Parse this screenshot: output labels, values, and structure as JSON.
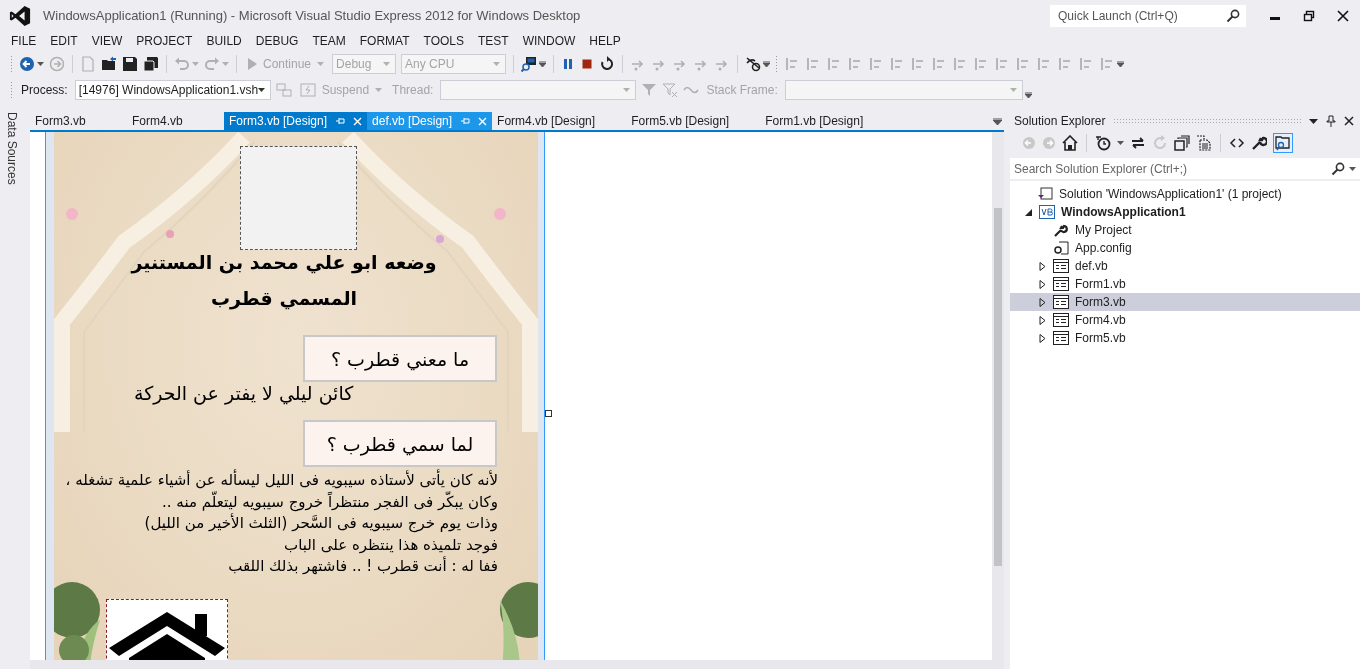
{
  "window": {
    "title": "WindowsApplication1 (Running) - Microsoft Visual Studio Express 2012 for Windows Desktop"
  },
  "quick_launch": {
    "placeholder": "Quick Launch (Ctrl+Q)"
  },
  "menu": [
    "FILE",
    "EDIT",
    "VIEW",
    "PROJECT",
    "BUILD",
    "DEBUG",
    "TEAM",
    "FORMAT",
    "TOOLS",
    "TEST",
    "WINDOW",
    "HELP"
  ],
  "debug_toolbar": {
    "continue": {
      "label": "Continue",
      "disabled": true
    },
    "configuration": {
      "value": "Debug",
      "disabled": true
    },
    "platform": {
      "value": "Any CPU",
      "disabled": true
    }
  },
  "debug_location": {
    "process_label": "Process:",
    "process": "[14976] WindowsApplication1.vsh",
    "suspend": {
      "label": "Suspend",
      "disabled": true
    },
    "thread_label": "Thread:",
    "stack_frame_label": "Stack Frame:"
  },
  "side_tab": "Data Sources",
  "document_tabs": [
    {
      "label": "Form3.vb",
      "selected": false,
      "pinned": false,
      "hovered": false
    },
    {
      "label": "Form4.vb",
      "selected": false,
      "pinned": false,
      "hovered": false
    },
    {
      "label": "Form3.vb [Design]",
      "selected": true,
      "pinned": true,
      "hovered": false
    },
    {
      "label": "def.vb [Design]",
      "selected": false,
      "pinned": true,
      "hovered": true
    },
    {
      "label": "Form4.vb [Design]",
      "selected": false,
      "pinned": false,
      "hovered": false
    },
    {
      "label": "Form5.vb [Design]",
      "selected": false,
      "pinned": false,
      "hovered": false
    },
    {
      "label": "Form1.vb [Design]",
      "selected": false,
      "pinned": false,
      "hovered": false
    }
  ],
  "form": {
    "heading": "وضعه ابو علي محمد بن المستنير\nالمسمي قطرب",
    "buttons": [
      "ما معني قطرب ؟",
      "لما سمي قطرب ؟"
    ],
    "answer": "كائن ليلي لا يفتر عن الحركة",
    "story": "لأنه كان يأتى لأستاذه سيبويه فى الليل ليسأله عن أشياء علمية تشغله ،\nوكان يبكّر فى الفجر منتظراً خروج سيبويه ليتعلّم منه ..\nوذات يوم خرج سيبويه فى السَّحر (الثلث الأخير من الليل)\nفوجد تلميذه هذا ينتظره على الباب\nففا له : أنت قطرب ! .. فاشتهر بذلك اللقب"
  },
  "solution_explorer": {
    "title": "Solution Explorer",
    "search": {
      "placeholder": "Search Solution Explorer (Ctrl+;)"
    },
    "tree": [
      {
        "label": "Solution 'WindowsApplication1' (1 project)",
        "kind": "solution",
        "selected": false,
        "children": [
          {
            "label": "WindowsApplication1",
            "kind": "project",
            "expanded": true,
            "selected": false,
            "children": [
              {
                "label": "My Project",
                "kind": "settings",
                "selected": false
              },
              {
                "label": "App.config",
                "kind": "config",
                "selected": false
              },
              {
                "label": "def.vb",
                "kind": "form",
                "expanded": false,
                "selected": false
              },
              {
                "label": "Form1.vb",
                "kind": "form",
                "expanded": false,
                "selected": false
              },
              {
                "label": "Form3.vb",
                "kind": "form",
                "expanded": false,
                "selected": true
              },
              {
                "label": "Form4.vb",
                "kind": "form",
                "expanded": false,
                "selected": false
              },
              {
                "label": "Form5.vb",
                "kind": "form",
                "expanded": false,
                "selected": false
              }
            ]
          }
        ]
      }
    ]
  }
}
